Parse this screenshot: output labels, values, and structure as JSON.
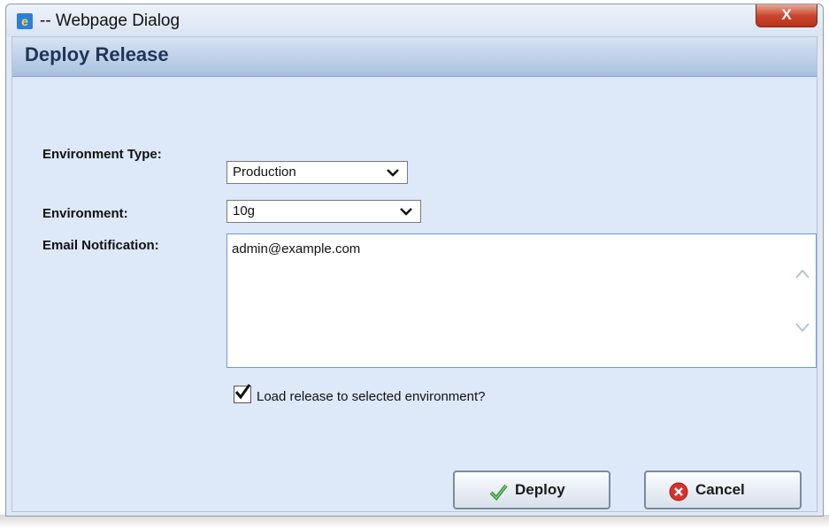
{
  "window": {
    "title": "-- Webpage Dialog",
    "close_label": "X"
  },
  "dialog": {
    "header": "Deploy Release",
    "environment_type": {
      "label": "Environment Type:",
      "value": "Production"
    },
    "environment": {
      "label": "Environment:",
      "value": "10g"
    },
    "email": {
      "label": "Email Notification:",
      "value": "admin@example.com"
    },
    "load_release": {
      "label": "Load release to selected environment?",
      "checked": true
    },
    "buttons": {
      "deploy": "Deploy",
      "cancel": "Cancel"
    }
  },
  "icons": {
    "window_icon": "ie-icon",
    "deploy_icon": "green-check-icon",
    "cancel_icon": "red-x-icon"
  }
}
